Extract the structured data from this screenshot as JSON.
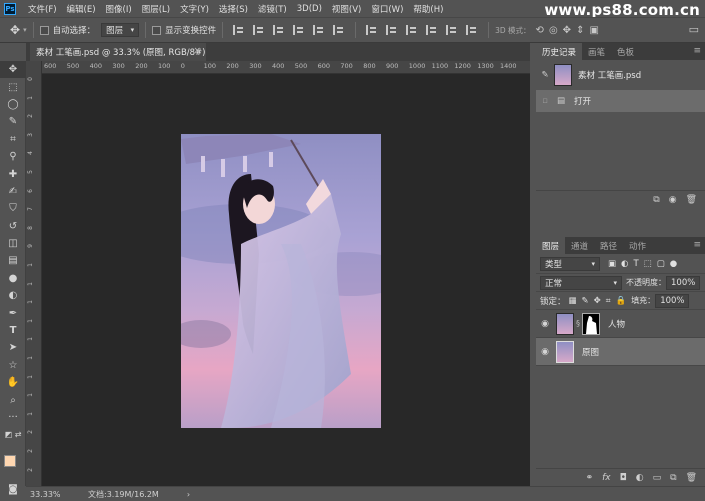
{
  "menubar": {
    "logo": "Ps",
    "items": [
      "文件(F)",
      "编辑(E)",
      "图像(I)",
      "图层(L)",
      "文字(Y)",
      "选择(S)",
      "滤镜(T)",
      "3D(D)",
      "视图(V)",
      "窗口(W)",
      "帮助(H)"
    ],
    "watermark": "www.ps88.com.cn"
  },
  "options": {
    "auto_select_label": "自动选择：",
    "auto_select_value": "图层",
    "show_transform_label": "显示变换控件",
    "mode_3d": "3D 模式："
  },
  "document": {
    "tab_title": "素材 工笔画.psd @ 33.3% (原图, RGB/8#)",
    "close_glyph": "×"
  },
  "ruler": {
    "h_labels": [
      "600",
      "500",
      "400",
      "300",
      "200",
      "100",
      "0",
      "100",
      "200",
      "300",
      "400",
      "500",
      "600",
      "700",
      "800",
      "900",
      "1000",
      "1100",
      "1200",
      "1300",
      "1400"
    ],
    "v_labels": [
      "0",
      "1",
      "2",
      "3",
      "4",
      "5",
      "6",
      "7",
      "8",
      "9",
      "1",
      "1",
      "1",
      "1",
      "1",
      "1",
      "1",
      "1",
      "1",
      "2",
      "2",
      "2"
    ]
  },
  "history_panel": {
    "tabs": [
      "历史记录",
      "画笔",
      "色板"
    ],
    "snapshot_label": "素材 工笔画.psd",
    "steps": [
      "打开"
    ]
  },
  "layers_panel": {
    "tabs": [
      "图层",
      "通道",
      "路径",
      "动作"
    ],
    "filter_label": "类型",
    "blend_mode": "正常",
    "opacity_label": "不透明度：",
    "opacity_value": "100%",
    "lock_label": "锁定：",
    "fill_label": "填充：",
    "fill_value": "100%",
    "layers": [
      {
        "name": "人物",
        "has_mask": true,
        "selected": false
      },
      {
        "name": "原图",
        "has_mask": false,
        "selected": true
      }
    ]
  },
  "status": {
    "zoom": "33.33%",
    "doc_info": "文档:3.19M/16.2M",
    "arrow": "›"
  },
  "colors": {
    "foreground": "#ffd7b1",
    "background": "#000000",
    "accent": "#31a8ff"
  }
}
